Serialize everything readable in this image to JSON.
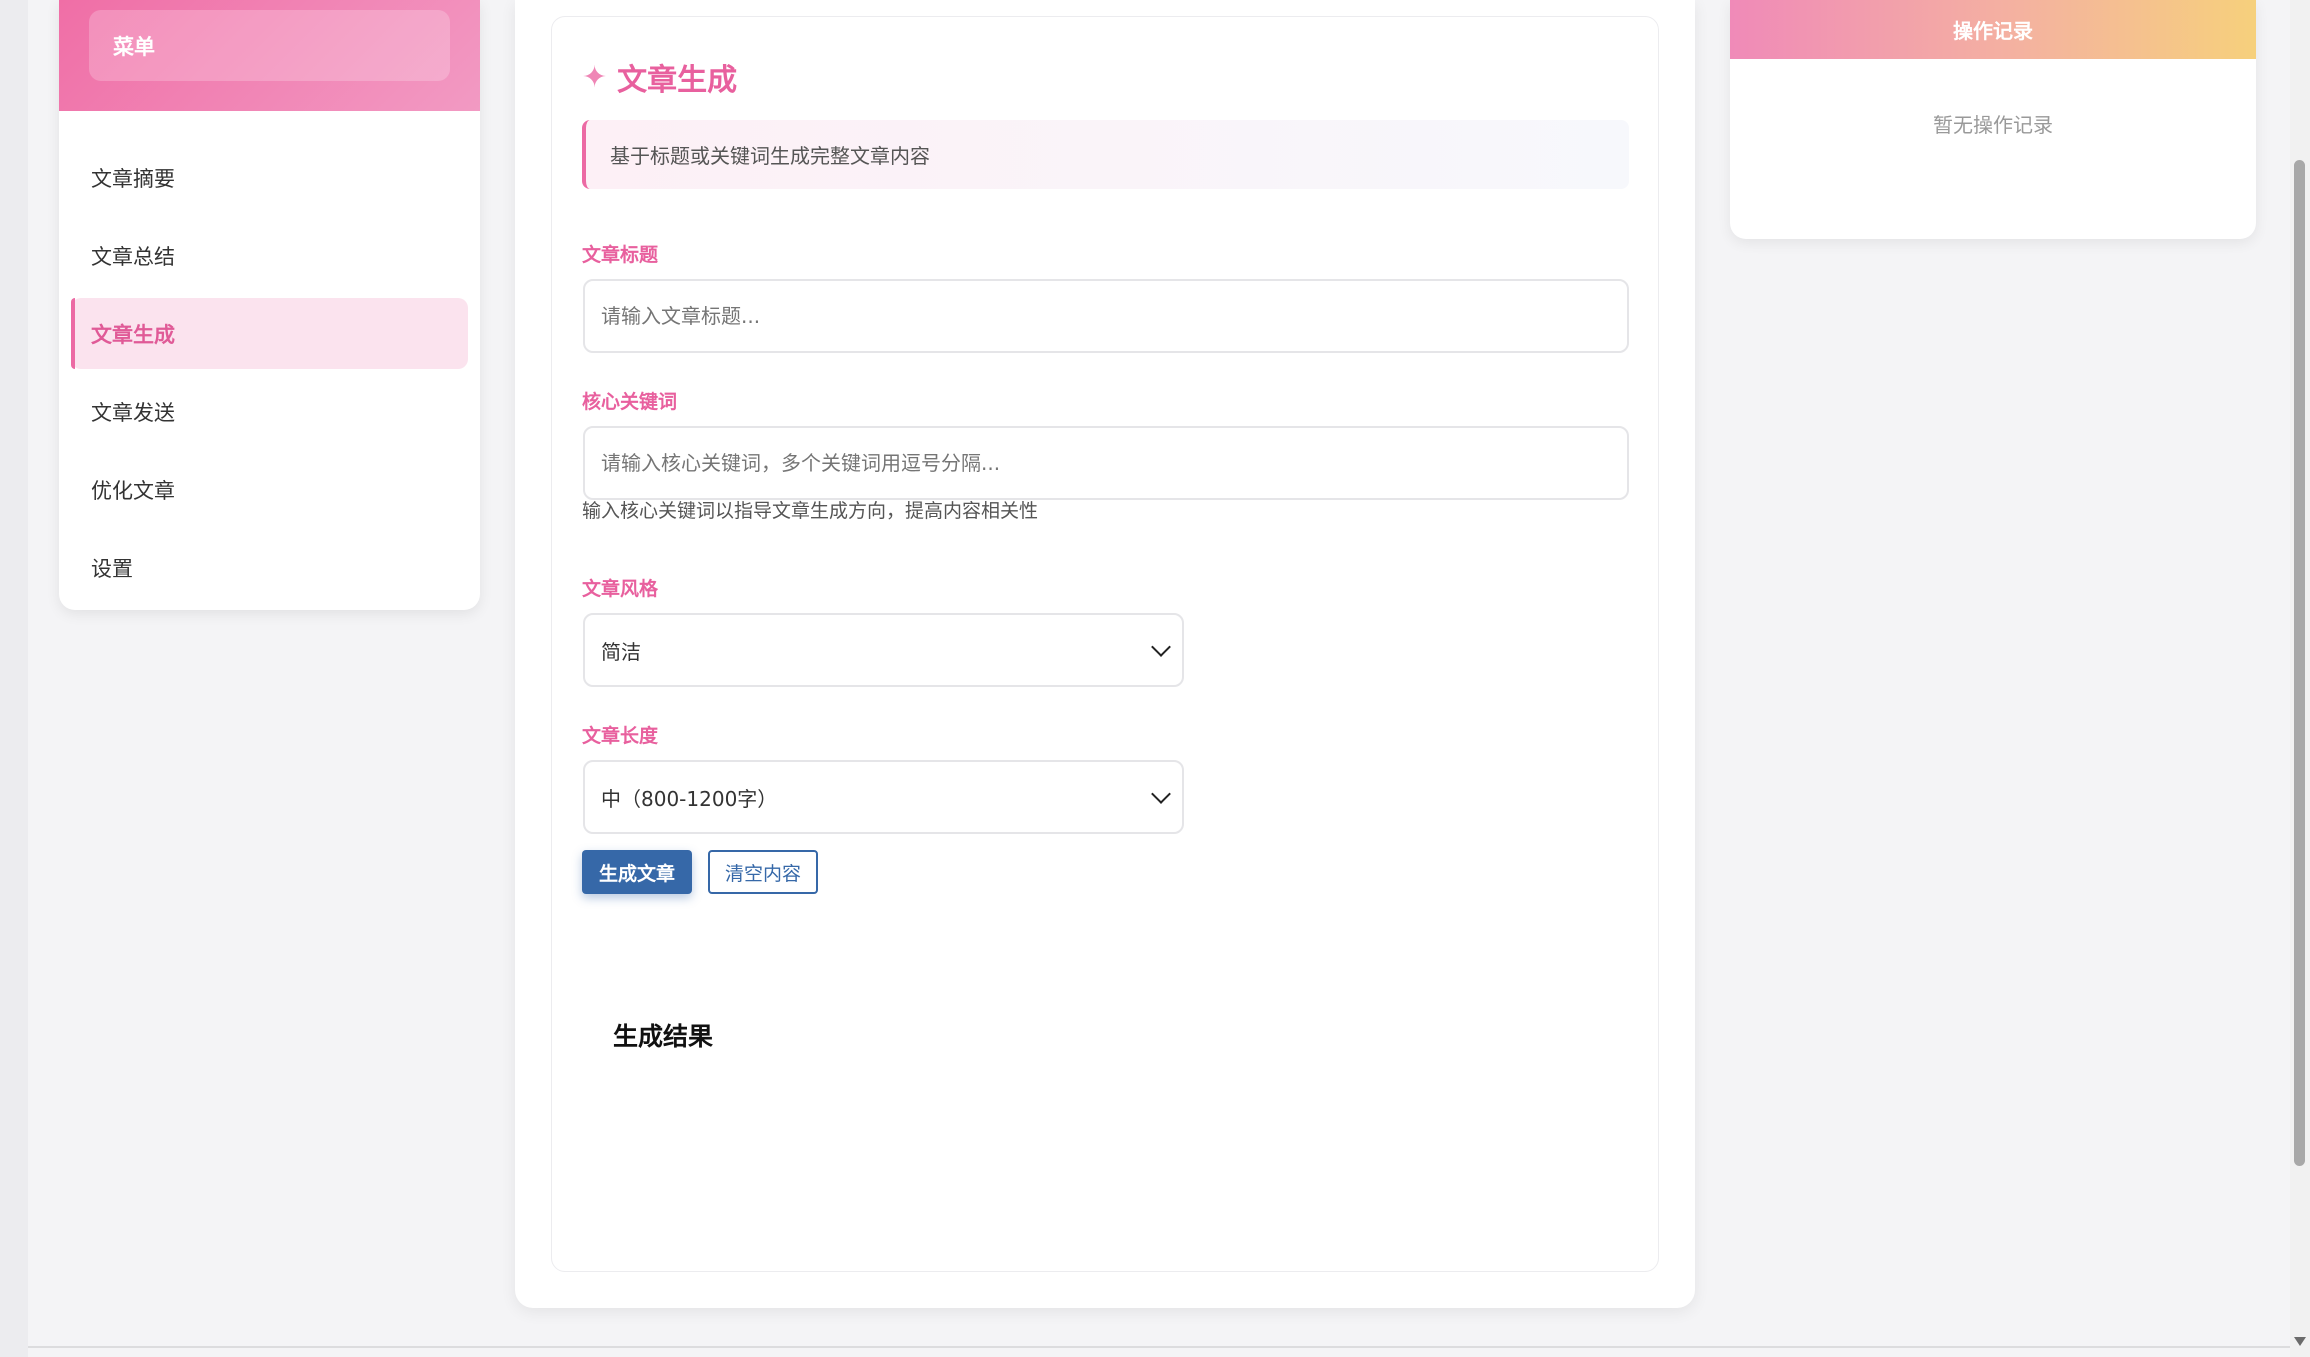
{
  "sidebar": {
    "header_label": "菜单",
    "items": [
      {
        "label": "文章摘要"
      },
      {
        "label": "文章总结"
      },
      {
        "label": "文章生成"
      },
      {
        "label": "文章发送"
      },
      {
        "label": "优化文章"
      },
      {
        "label": "设置"
      }
    ],
    "active_item": "文章生成"
  },
  "main": {
    "title_icon": "sparkle-icon",
    "title": "文章生成",
    "description": "基于标题或关键词生成完整文章内容",
    "title_field": {
      "label": "文章标题",
      "placeholder": "请输入文章标题...",
      "value": ""
    },
    "keywords_field": {
      "label": "核心关键词",
      "placeholder": "请输入核心关键词，多个关键词用逗号分隔...",
      "value": "",
      "hint": "输入核心关键词以指导文章生成方向，提高内容相关性"
    },
    "style_field": {
      "label": "文章风格",
      "selected": "简洁"
    },
    "length_field": {
      "label": "文章长度",
      "selected": "中（800-1200字）"
    },
    "generate_button": "生成文章",
    "clear_button": "清空内容",
    "result_title": "生成结果"
  },
  "right_panel": {
    "title": "操作记录",
    "empty_text": "暂无操作记录"
  },
  "colors": {
    "accent_pink": "#e8609e",
    "primary_blue": "#3668a8"
  }
}
